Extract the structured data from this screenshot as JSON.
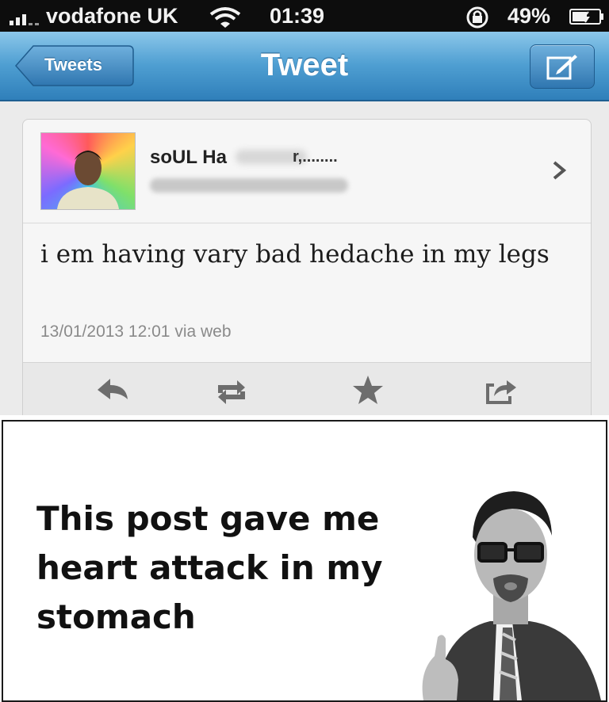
{
  "status_bar": {
    "carrier": "vodafone UK",
    "time": "01:39",
    "battery": "49%"
  },
  "nav": {
    "back_label": "Tweets",
    "title": "Tweet"
  },
  "tweet": {
    "username": "soUL Ha",
    "username_suffix": "r,........",
    "text": "i em having vary bad hedache in my legs",
    "meta": "13/01/2013 12:01 via web"
  },
  "meme": {
    "caption": "This post gave me heart attack in my stomach"
  },
  "colors": {
    "nav_blue": "#4f9fd2",
    "status_black": "#0d0d0d"
  }
}
